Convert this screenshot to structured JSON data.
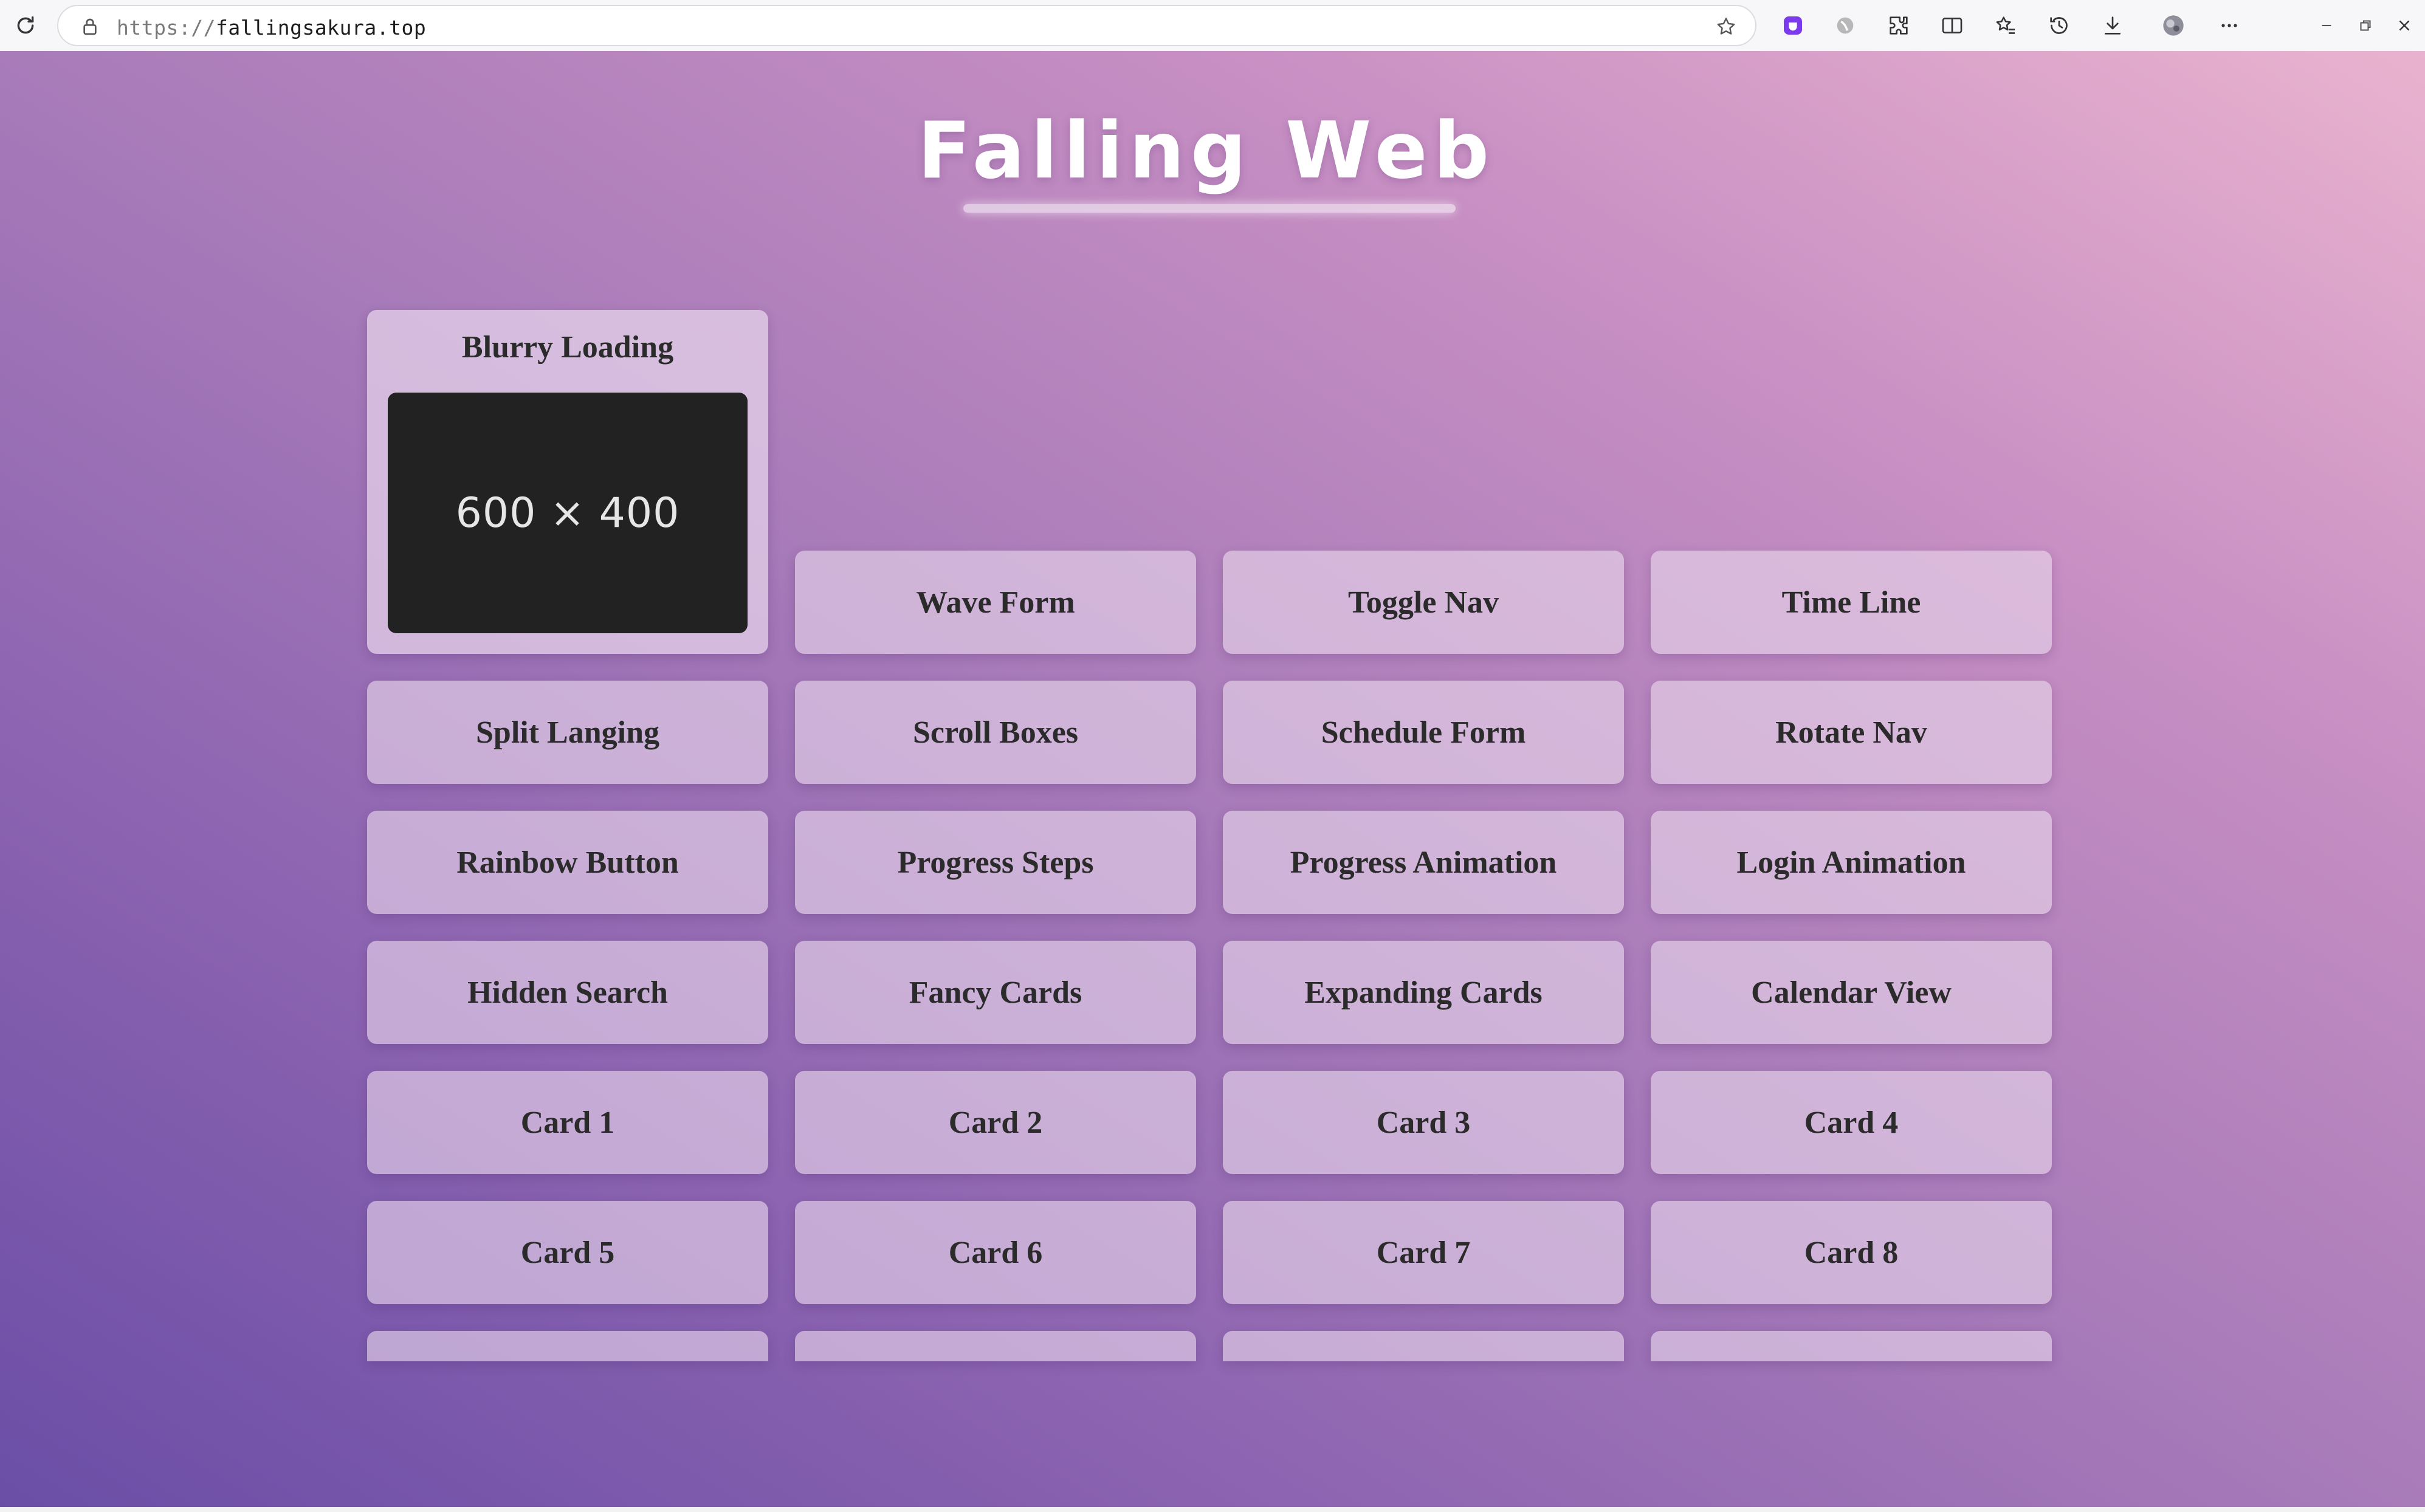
{
  "browser": {
    "url_scheme": "https://",
    "url_host": "fallingsakura.top",
    "icons": [
      "reload-icon",
      "lock-icon",
      "bookmark-star-icon",
      "extension-purple-icon",
      "extension-grey-icon",
      "extensions-puzzle-icon",
      "split-screen-icon",
      "favorites-icon",
      "history-icon",
      "downloads-icon",
      "profile-avatar-icon",
      "more-menu-icon",
      "minimize-icon",
      "restore-icon",
      "close-icon"
    ]
  },
  "page": {
    "title": "Falling Web",
    "featured": {
      "title": "Blurry Loading",
      "placeholder_text": "600 × 400"
    },
    "tiles": [
      "Wave Form",
      "Toggle Nav",
      "Time Line",
      "Split Langing",
      "Scroll Boxes",
      "Schedule Form",
      "Rotate Nav",
      "Rainbow Button",
      "Progress Steps",
      "Progress Animation",
      "Login Animation",
      "Hidden Search",
      "Fancy Cards",
      "Expanding Cards",
      "Calendar View",
      "Card 1",
      "Card 2",
      "Card 3",
      "Card 4",
      "Card 5",
      "Card 6",
      "Card 7",
      "Card 8"
    ],
    "colors": {
      "gradient_start": "#6a4ea6",
      "gradient_end": "#e9b3cf",
      "tile_text": "#2b2b2b"
    }
  }
}
